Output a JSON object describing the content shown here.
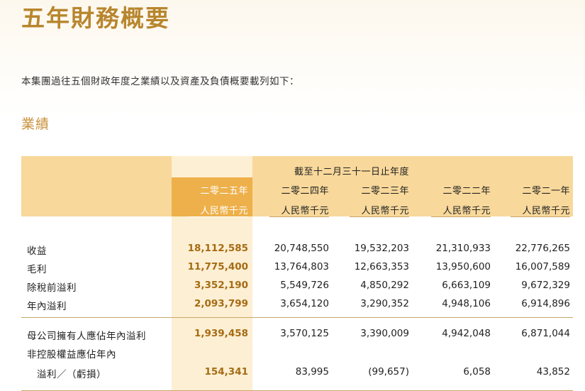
{
  "title": "五年財務概要",
  "intro": "本集團過往五個財政年度之業績以及資產及負債概要載列如下：",
  "section": "業績",
  "table": {
    "span_header": "截至十二月三十一日止年度",
    "columns": [
      {
        "year": "二零二五年",
        "unit": "人民幣千元",
        "highlight": true
      },
      {
        "year": "二零二四年",
        "unit": "人民幣千元",
        "highlight": false
      },
      {
        "year": "二零二三年",
        "unit": "人民幣千元",
        "highlight": false
      },
      {
        "year": "二零二二年",
        "unit": "人民幣千元",
        "highlight": false
      },
      {
        "year": "二零二一年",
        "unit": "人民幣千元",
        "highlight": false
      }
    ],
    "rows": [
      {
        "label": "收益",
        "values": [
          "18,112,585",
          "20,748,550",
          "19,532,203",
          "21,310,933",
          "22,776,265"
        ]
      },
      {
        "label": "毛利",
        "values": [
          "11,775,400",
          "13,764,803",
          "12,663,353",
          "13,950,600",
          "16,007,589"
        ]
      },
      {
        "label": "除稅前溢利",
        "values": [
          "3,352,190",
          "5,549,726",
          "4,850,292",
          "6,663,109",
          "9,672,329"
        ]
      },
      {
        "label": "年內溢利",
        "values": [
          "2,093,799",
          "3,654,120",
          "3,290,352",
          "4,948,106",
          "6,914,896"
        ]
      },
      {
        "label": "母公司擁有人應佔年內溢利",
        "values": [
          "1,939,458",
          "3,570,125",
          "3,390,009",
          "4,942,048",
          "6,871,044"
        ]
      },
      {
        "label": "非控股權益應佔年內",
        "values": [
          "",
          "",
          "",
          "",
          ""
        ]
      },
      {
        "label": "　溢利／（虧損）",
        "values": [
          "154,341",
          "83,995",
          "(99,657)",
          "6,058",
          "43,852"
        ]
      }
    ]
  },
  "colors": {
    "accent": "#b8862e",
    "header_band": "#f8d89b",
    "highlight_col": "#eeb04a",
    "highlight_bg": "#fdefd3"
  }
}
